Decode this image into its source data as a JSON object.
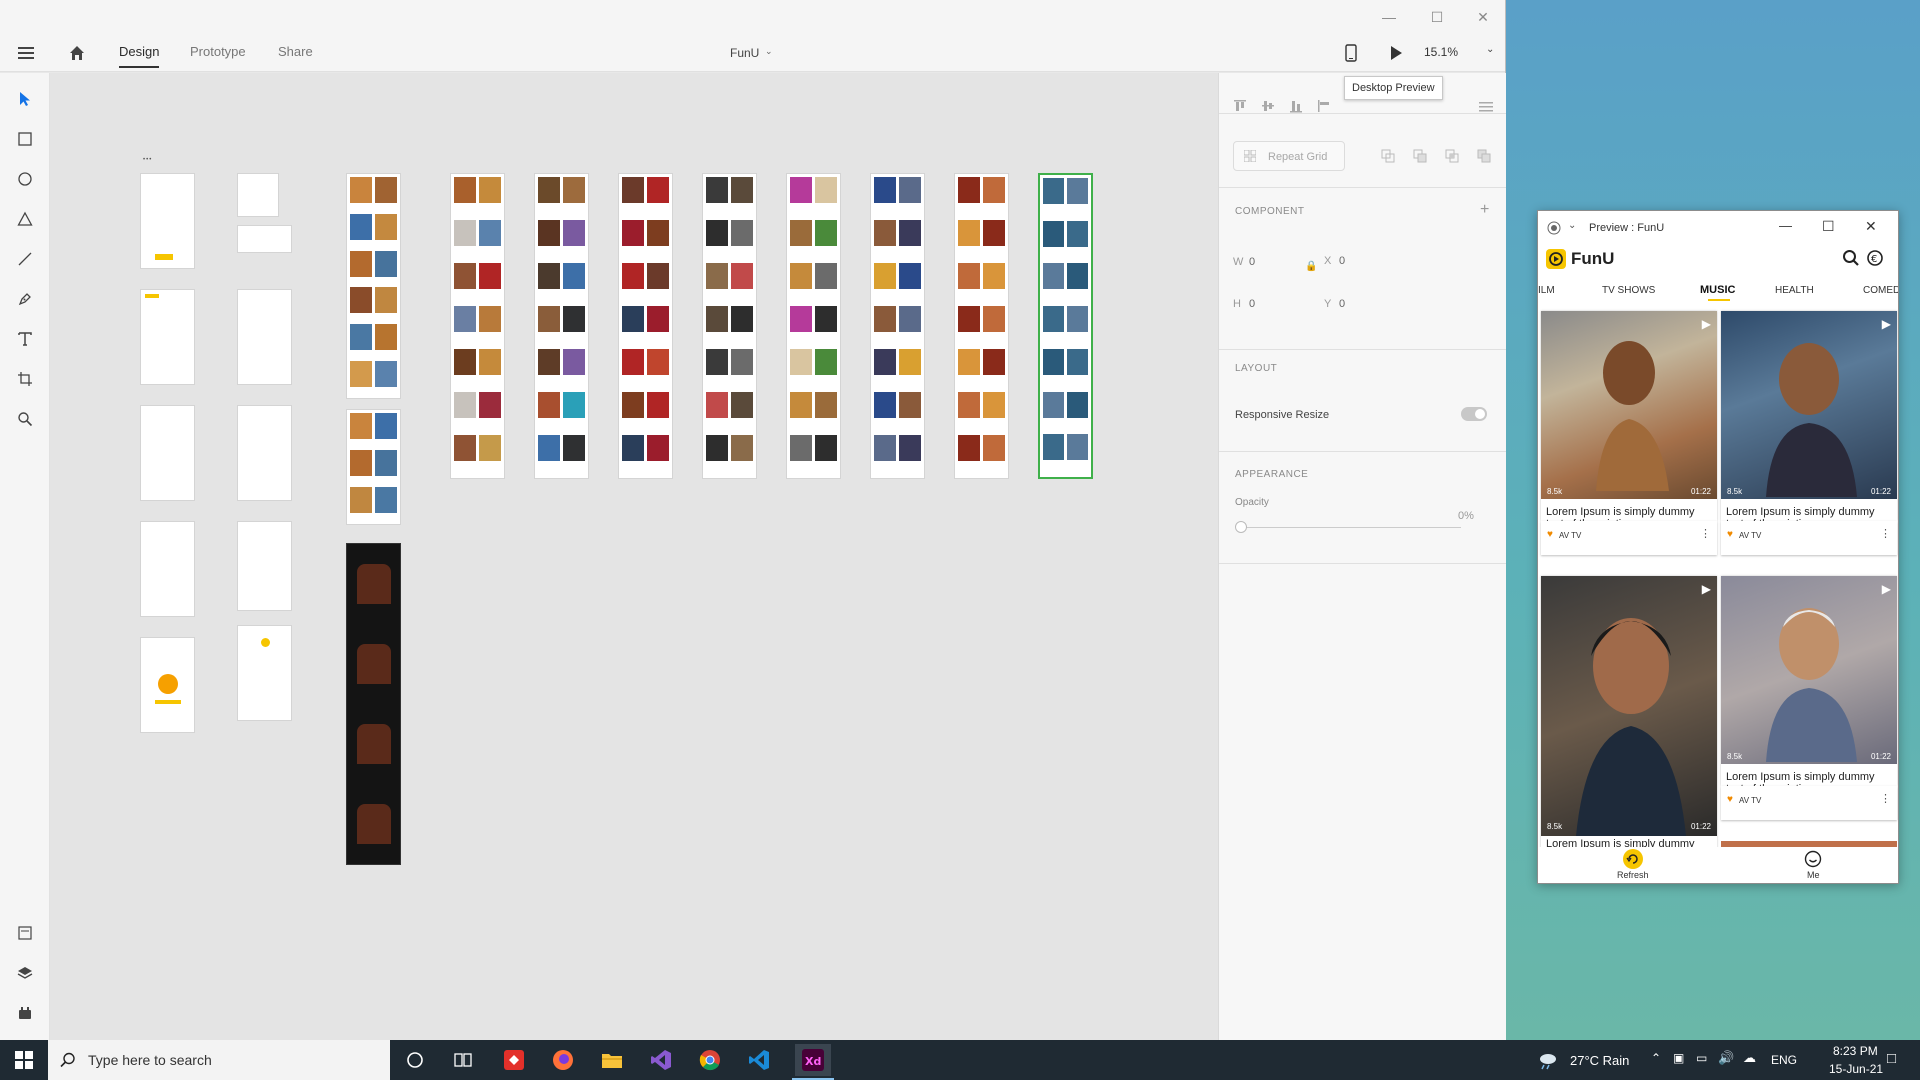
{
  "app": {
    "document_title": "FunU",
    "tabs": [
      {
        "label": "Design",
        "active": true
      },
      {
        "label": "Prototype",
        "active": false
      },
      {
        "label": "Share",
        "active": false
      }
    ],
    "zoom": "15.1%",
    "tooltip": "Desktop Preview"
  },
  "toolbar": {
    "tools": [
      "select-tool",
      "rectangle-tool",
      "ellipse-tool",
      "polygon-tool",
      "line-tool",
      "pen-tool",
      "text-tool",
      "artboard-tool",
      "zoom-tool"
    ],
    "bottom_tools": [
      "assets-panel",
      "layers-panel",
      "plugins-panel"
    ]
  },
  "properties": {
    "repeat_grid_label": "Repeat Grid",
    "component_heading": "COMPONENT",
    "w_label": "W",
    "w_value": "0",
    "h_label": "H",
    "h_value": "0",
    "x_label": "X",
    "x_value": "0",
    "y_label": "Y",
    "y_value": "0",
    "layout_heading": "LAYOUT",
    "responsive_resize_label": "Responsive Resize",
    "appearance_heading": "APPEARANCE",
    "opacity_label": "Opacity",
    "opacity_value": "0%"
  },
  "preview": {
    "window_title": "Preview : FunU",
    "app_name": "FunU",
    "categories": [
      "ILM",
      "TV SHOWS",
      "MUSIC",
      "HEALTH",
      "COMED"
    ],
    "active_category": "MUSIC",
    "cards": [
      {
        "title": "Lorem Ipsum is simply dummy text of the printing",
        "views": "8.5k",
        "duration": "01:22",
        "channel": "AV TV"
      },
      {
        "title": "Lorem Ipsum is simply dummy text of the printing",
        "views": "8.5k",
        "duration": "01:22",
        "channel": "AV TV"
      },
      {
        "title": "Lorem Ipsum is simply dummy",
        "views": "8.5k",
        "duration": "01:22",
        "channel": ""
      },
      {
        "title": "Lorem Ipsum is simply dummy text of the printing",
        "views": "8.5k",
        "duration": "01:22",
        "channel": "AV TV"
      }
    ],
    "nav": {
      "refresh_label": "Refresh",
      "me_label": "Me"
    }
  },
  "taskbar": {
    "search_placeholder": "Type here to search",
    "weather": "27°C  Rain",
    "language": "ENG",
    "time": "8:23 PM",
    "date": "15-Jun-21"
  },
  "colors": {
    "accent_yellow": "#f6c500",
    "xd_purple": "#470137",
    "xd_pink": "#ff61f6",
    "select_blue": "#1473e6"
  }
}
